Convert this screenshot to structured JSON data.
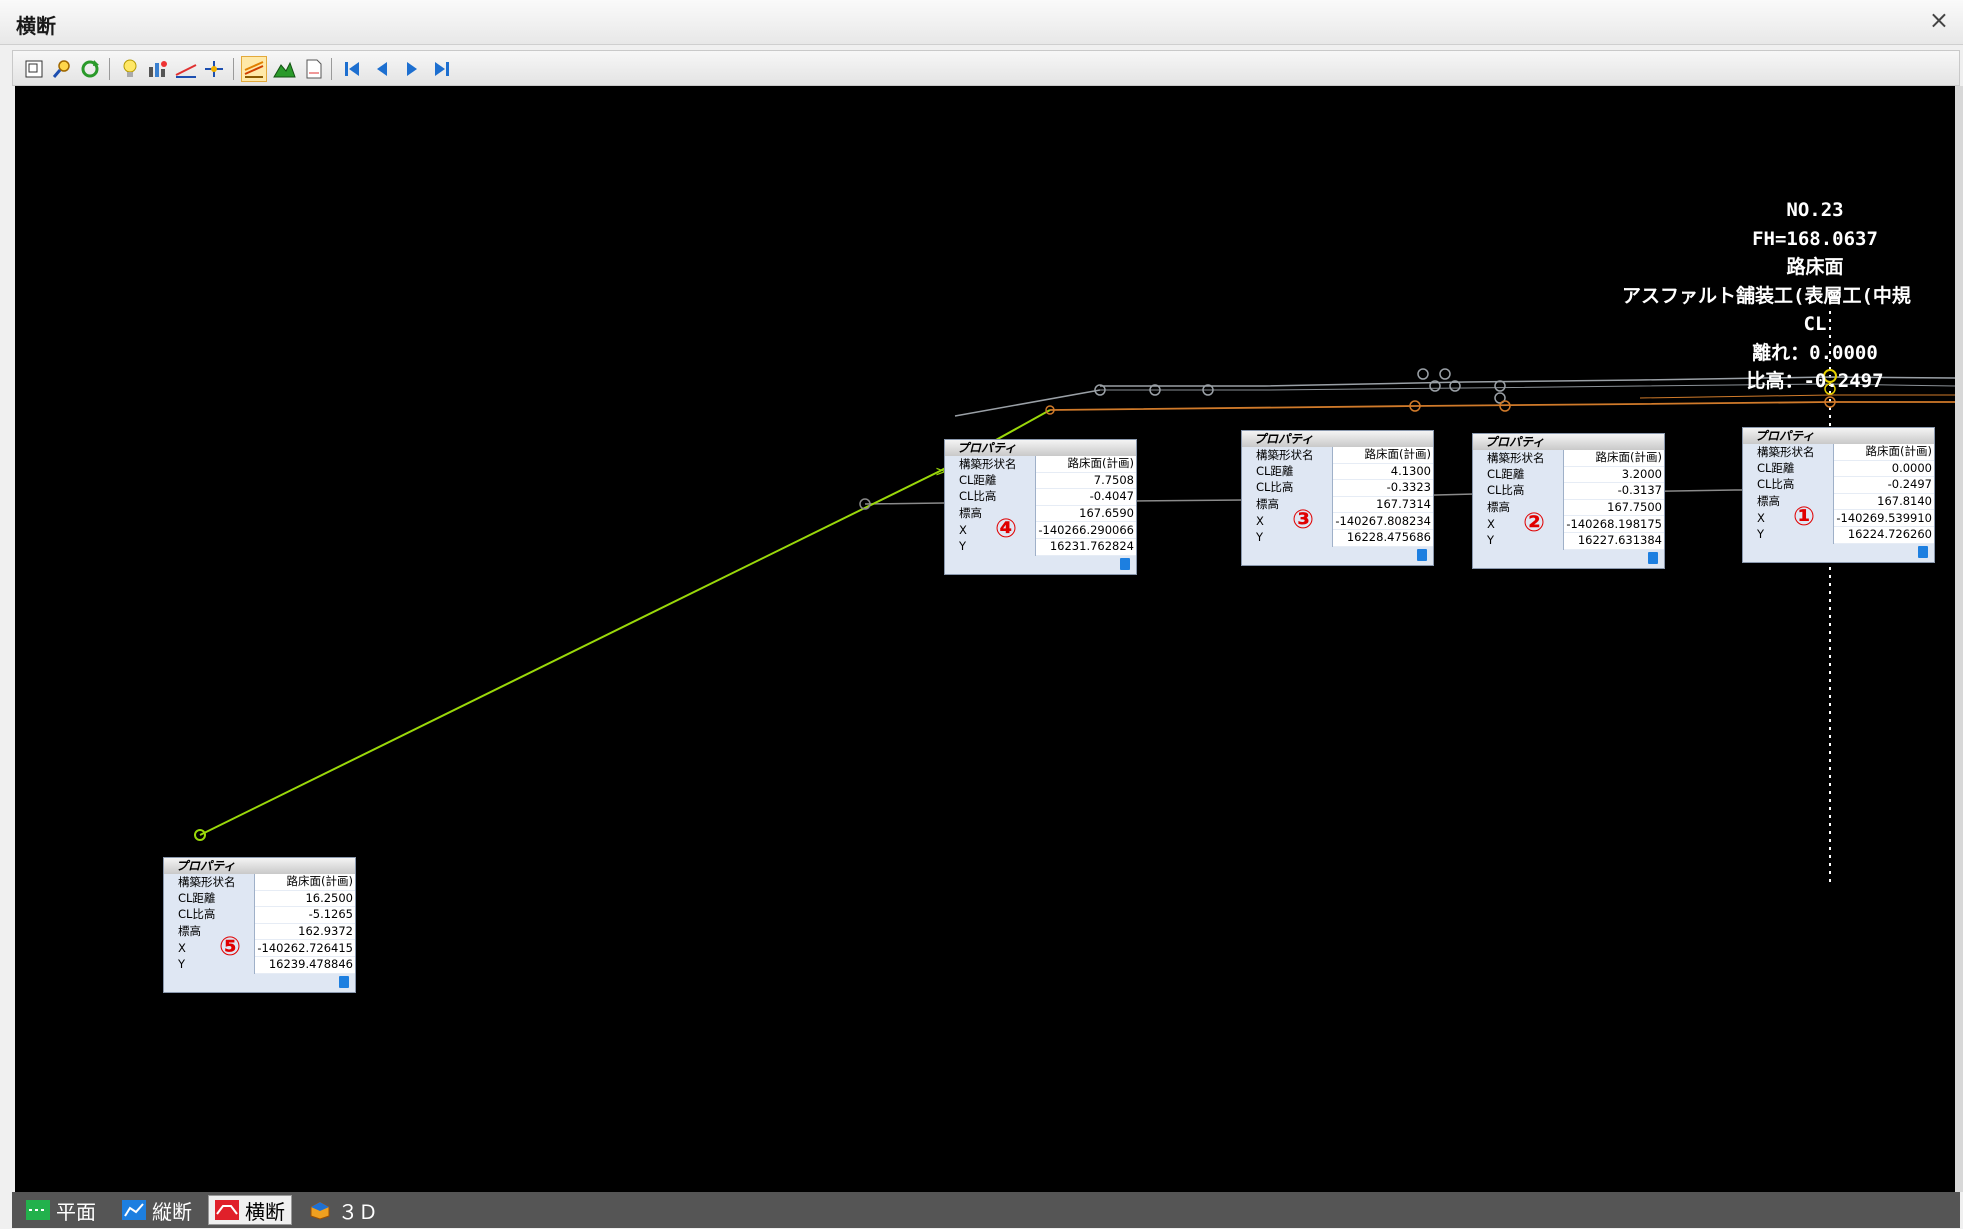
{
  "window": {
    "title": "横断",
    "close_glyph": "×"
  },
  "toolbar": {
    "buttons": [
      {
        "name": "zoom-window-icon",
        "glyph": "⊡"
      },
      {
        "name": "zoom-search-icon",
        "glyph": "🔍"
      },
      {
        "name": "refresh-icon",
        "glyph": "⟳"
      },
      {
        "name": "lightbulb-icon",
        "glyph": "💡"
      },
      {
        "name": "settings-icon",
        "glyph": "⚙"
      },
      {
        "name": "ruler-icon",
        "glyph": "📏"
      },
      {
        "name": "point-icon",
        "glyph": "✛"
      },
      {
        "name": "layers-icon",
        "glyph": "≋"
      },
      {
        "name": "terrain-icon",
        "glyph": "⛰"
      },
      {
        "name": "document-icon",
        "glyph": "🗎"
      },
      {
        "name": "first-icon",
        "glyph": "⏮"
      },
      {
        "name": "prev-icon",
        "glyph": "◀"
      },
      {
        "name": "next-icon",
        "glyph": "▶"
      },
      {
        "name": "last-icon",
        "glyph": "⏭"
      }
    ]
  },
  "header": {
    "no": "NO.23",
    "fh": "FH=168.0637",
    "surface": "路床面",
    "work": "アスファルト舗装工(表層工(中規",
    "cl": "CL",
    "offset": "離れ：0.0000",
    "height": "比高：-0.2497"
  },
  "props": [
    {
      "marker": "④",
      "title": "プロパティ",
      "rows": [
        {
          "k": "構築形状名",
          "v": "路床面(計画)"
        },
        {
          "k": "CL距離",
          "v": "7.7508"
        },
        {
          "k": "CL比高",
          "v": "-0.4047"
        },
        {
          "k": "標高",
          "v": "167.6590"
        },
        {
          "k": "X",
          "v": "-140266.290066"
        },
        {
          "k": "Y",
          "v": "16231.762824"
        }
      ]
    },
    {
      "marker": "③",
      "title": "プロパティ",
      "rows": [
        {
          "k": "構築形状名",
          "v": "路床面(計画)"
        },
        {
          "k": "CL距離",
          "v": "4.1300"
        },
        {
          "k": "CL比高",
          "v": "-0.3323"
        },
        {
          "k": "標高",
          "v": "167.7314"
        },
        {
          "k": "X",
          "v": "-140267.808234"
        },
        {
          "k": "Y",
          "v": "16228.475686"
        }
      ]
    },
    {
      "marker": "②",
      "title": "プロパティ",
      "rows": [
        {
          "k": "構築形状名",
          "v": "路床面(計画)"
        },
        {
          "k": "CL距離",
          "v": "3.2000"
        },
        {
          "k": "CL比高",
          "v": "-0.3137"
        },
        {
          "k": "標高",
          "v": "167.7500"
        },
        {
          "k": "X",
          "v": "-140268.198175"
        },
        {
          "k": "Y",
          "v": "16227.631384"
        }
      ]
    },
    {
      "marker": "①",
      "title": "プロパティ",
      "rows": [
        {
          "k": "構築形状名",
          "v": "路床面(計画)"
        },
        {
          "k": "CL距離",
          "v": "0.0000"
        },
        {
          "k": "CL比高",
          "v": "-0.2497"
        },
        {
          "k": "標高",
          "v": "167.8140"
        },
        {
          "k": "X",
          "v": "-140269.539910"
        },
        {
          "k": "Y",
          "v": "16224.726260"
        }
      ]
    },
    {
      "marker": "⑤",
      "title": "プロパティ",
      "rows": [
        {
          "k": "構築形状名",
          "v": "路床面(計画)"
        },
        {
          "k": "CL距離",
          "v": "16.2500"
        },
        {
          "k": "CL比高",
          "v": "-5.1265"
        },
        {
          "k": "標高",
          "v": "162.9372"
        },
        {
          "k": "X",
          "v": "-140262.726415"
        },
        {
          "k": "Y",
          "v": "16239.478846"
        }
      ]
    }
  ],
  "tabs": [
    {
      "label": "平面",
      "icon": "plan-icon",
      "color": "#22b14c"
    },
    {
      "label": "縦断",
      "icon": "profile-icon",
      "color": "#1d7fe0"
    },
    {
      "label": "横断",
      "icon": "cross-section-icon",
      "color": "#e0202a"
    },
    {
      "label": "３Ｄ",
      "icon": "3d-icon",
      "color": "#f0a020"
    }
  ],
  "colors": {
    "canvas_bg": "#000000",
    "surface_line": "#9aa0a6",
    "orange_line": "#d07a2a",
    "green_line": "#9ad80a",
    "highlight": "#e6d000"
  }
}
